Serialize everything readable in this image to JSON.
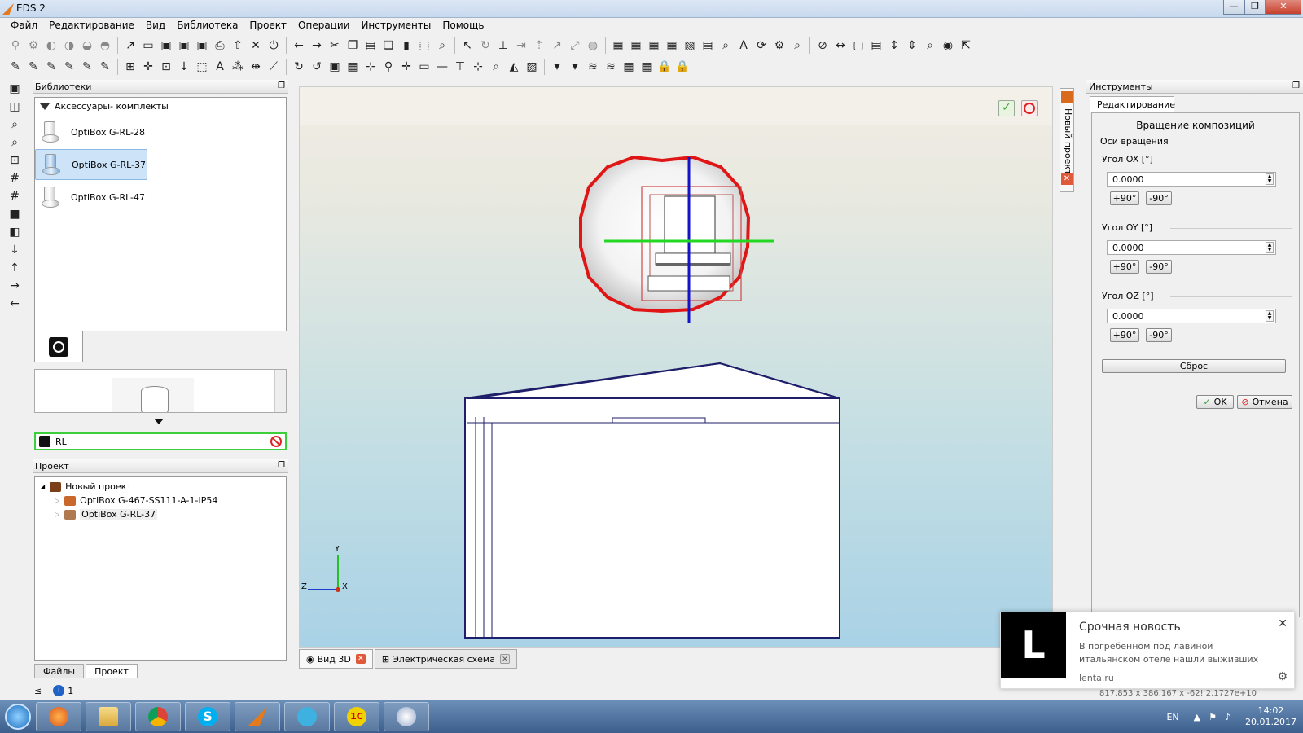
{
  "window": {
    "title": "EDS 2",
    "minimize": "—",
    "maximize": "❐",
    "close": "✕"
  },
  "menu": [
    "Файл",
    "Редактирование",
    "Вид",
    "Библиотека",
    "Проект",
    "Операции",
    "Инструменты",
    "Помощь"
  ],
  "libraries_panel": {
    "title": "Библиотеки",
    "category": "Аксессуары- комплекты",
    "items": [
      "OptiBox G-RL-28",
      "OptiBox G-RL-37",
      "OptiBox G-RL-47"
    ],
    "selected_index": 1,
    "filter_value": "RL"
  },
  "project_panel": {
    "title": "Проект",
    "root": "Новый проект",
    "children": [
      "OptiBox G-467-SS111-A-1-IP54",
      "OptiBox G-RL-37"
    ]
  },
  "bottom_tabs": [
    "Файлы",
    "Проект"
  ],
  "status": {
    "count": "1"
  },
  "viewport": {
    "axis_y": "Y",
    "axis_z": "Z",
    "axis_x": "X",
    "side_tab": "Новый проект"
  },
  "view_tabs": [
    "Вид 3D",
    "Электрическая схема"
  ],
  "tools_panel": {
    "title": "Инструменты",
    "tab": "Редактирование",
    "heading": "Вращение композиций",
    "axes_label": "Оси вращения",
    "angles": [
      {
        "label": "Угол OX [°]",
        "value": "0.0000"
      },
      {
        "label": "Угол OY [°]",
        "value": "0.0000"
      },
      {
        "label": "Угол OZ [°]",
        "value": "0.0000"
      }
    ],
    "plus90": "+90°",
    "minus90": "-90°",
    "reset": "Сброс",
    "ok": "OK",
    "cancel": "Отмена"
  },
  "notification": {
    "logo": "L",
    "title": "Срочная новость",
    "body": "В погребенном под лавиной итальянском отеле нашли выживших",
    "source": "lenta.ru"
  },
  "coords_text": "817.853 x 386.167 x -62!      2.1727e+10",
  "taskbar": {
    "lang": "EN",
    "time": "14:02",
    "date": "20.01.2017"
  }
}
